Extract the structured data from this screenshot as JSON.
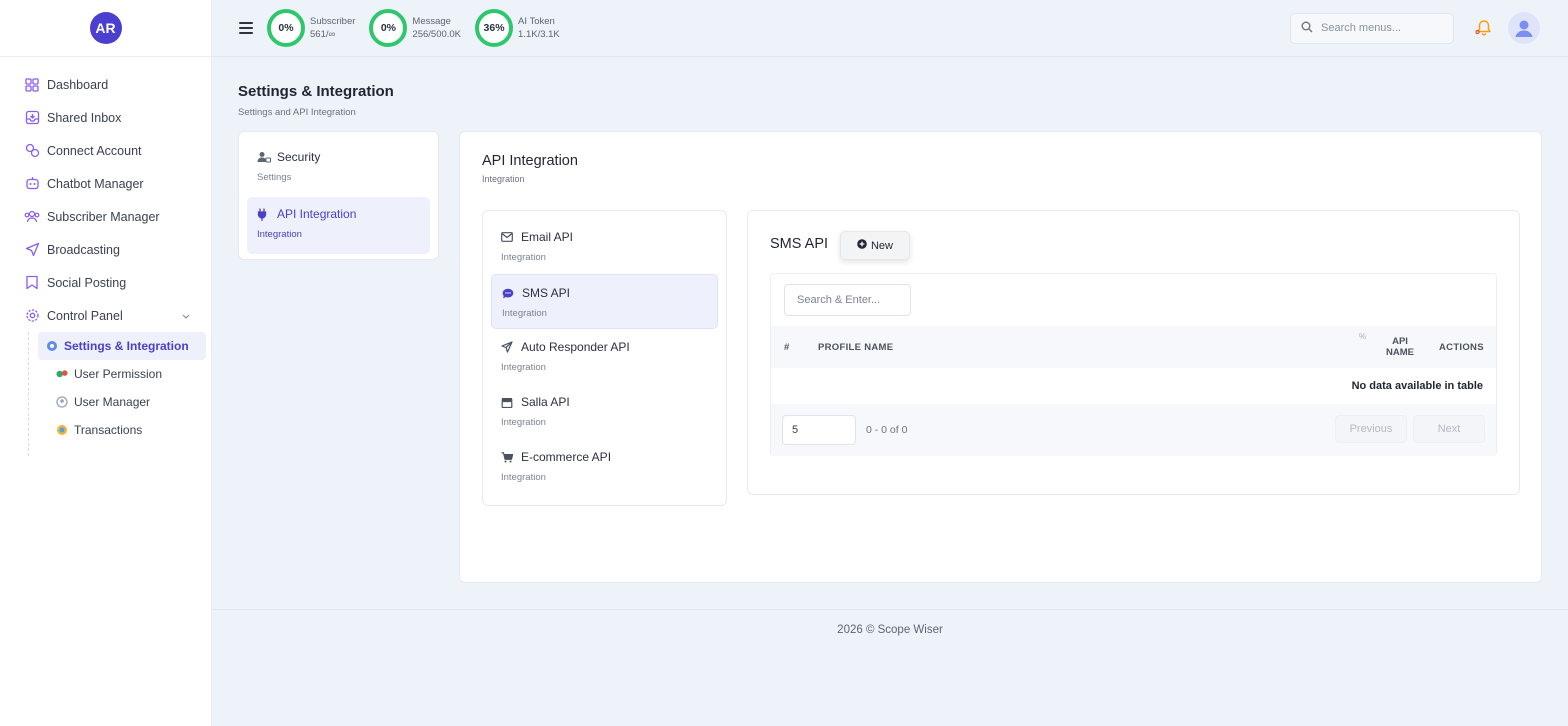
{
  "sidebar": {
    "logo_initials": "AR",
    "items": [
      {
        "label": "Dashboard",
        "icon": "dashboard-icon"
      },
      {
        "label": "Shared Inbox",
        "icon": "inbox-icon"
      },
      {
        "label": "Connect Account",
        "icon": "link-icon"
      },
      {
        "label": "Chatbot Manager",
        "icon": "bot-icon"
      },
      {
        "label": "Subscriber Manager",
        "icon": "users-icon"
      },
      {
        "label": "Broadcasting",
        "icon": "send-icon"
      },
      {
        "label": "Social Posting",
        "icon": "bookmark-icon"
      },
      {
        "label": "Control Panel",
        "icon": "gear-icon"
      }
    ],
    "subitems": [
      {
        "label": "Settings & Integration",
        "icon": "settings-icon",
        "active": true
      },
      {
        "label": "User Permission",
        "icon": "permission-icon"
      },
      {
        "label": "User Manager",
        "icon": "user-manager-icon"
      },
      {
        "label": "Transactions",
        "icon": "transactions-icon"
      }
    ]
  },
  "header": {
    "stats": [
      {
        "percent": "0%",
        "label": "Subscriber",
        "value": "561/∞"
      },
      {
        "percent": "0%",
        "label": "Message",
        "value": "256/500.0K"
      },
      {
        "percent": "36%",
        "label": "AI Token",
        "value": "1.1K/3.1K"
      }
    ],
    "search_placeholder": "Search menus..."
  },
  "page": {
    "title": "Settings & Integration",
    "subtitle": "Settings and API Integration"
  },
  "settings_menu": [
    {
      "title": "Security",
      "sub": "Settings",
      "icon": "user-lock-icon"
    },
    {
      "title": "API Integration",
      "sub": "Integration",
      "icon": "plug-icon",
      "active": true
    }
  ],
  "api_integration": {
    "title": "API Integration",
    "subtitle": "Integration",
    "apis": [
      {
        "title": "Email API",
        "sub": "Integration",
        "icon": "envelope-icon"
      },
      {
        "title": "SMS API",
        "sub": "Integration",
        "icon": "chat-icon",
        "active": true
      },
      {
        "title": "Auto Responder API",
        "sub": "Integration",
        "icon": "paper-plane-icon"
      },
      {
        "title": "Salla API",
        "sub": "Integration",
        "icon": "store-icon"
      },
      {
        "title": "E-commerce API",
        "sub": "Integration",
        "icon": "cart-icon"
      }
    ]
  },
  "sms": {
    "title": "SMS API",
    "new_label": "New",
    "search_placeholder": "Search & Enter...",
    "columns": {
      "num": "#",
      "profile": "PROFILE NAME",
      "pct": "%",
      "api_line1": "API",
      "api_line2": "NAME",
      "actions": "ACTIONS"
    },
    "empty_text": "No data available in table",
    "page_length": "5",
    "range_info": "0 - 0 of 0",
    "prev_label": "Previous",
    "next_label": "Next"
  },
  "footer": {
    "text": "2026 © Scope Wiser"
  },
  "colors": {
    "accent": "#4a41c6",
    "ring": "#2fc76d",
    "bell": "#f59e0b"
  }
}
